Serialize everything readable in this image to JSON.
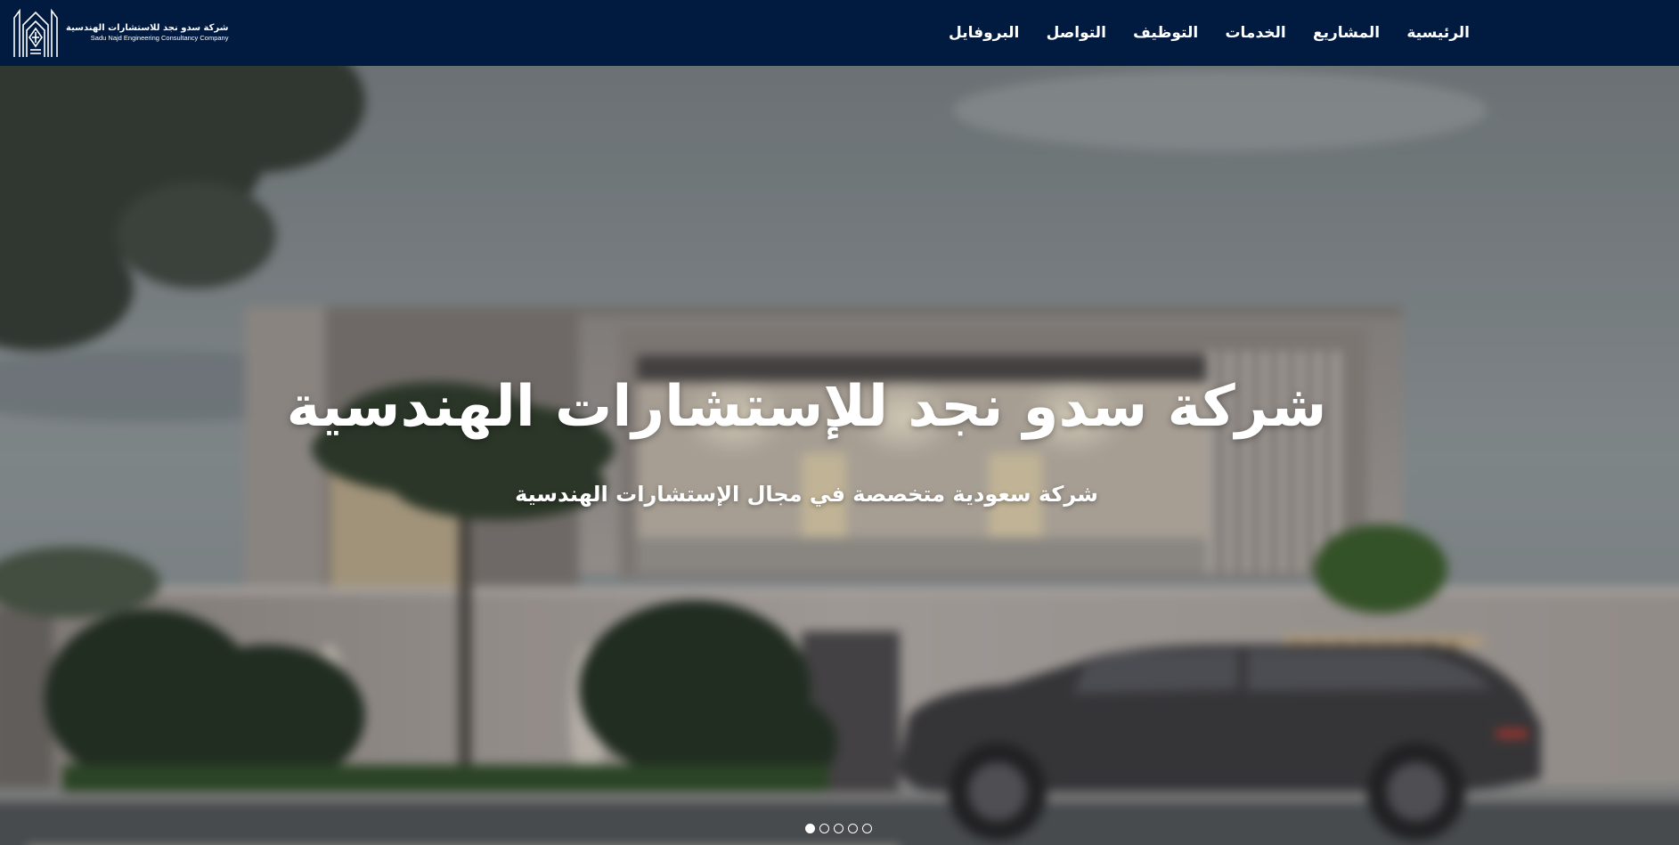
{
  "header": {
    "logo": {
      "name_ar": "شركة سدو نجد للاستشارات الهندسية",
      "name_en": "Sadu Najd Engineering Consultancy Company"
    },
    "nav": [
      {
        "label": "الرئيسية"
      },
      {
        "label": "المشاريع"
      },
      {
        "label": "الخدمات"
      },
      {
        "label": "التوظيف"
      },
      {
        "label": "التواصل"
      },
      {
        "label": "البروفايل"
      }
    ],
    "background_color": "#001a40"
  },
  "hero": {
    "title": "شركة سدو نجد للإستشارات الهندسية",
    "subtitle": "شركة سعودية متخصصة في مجال الإستشارات الهندسية",
    "slider": {
      "total_slides": 5,
      "active_slide": 1
    }
  }
}
